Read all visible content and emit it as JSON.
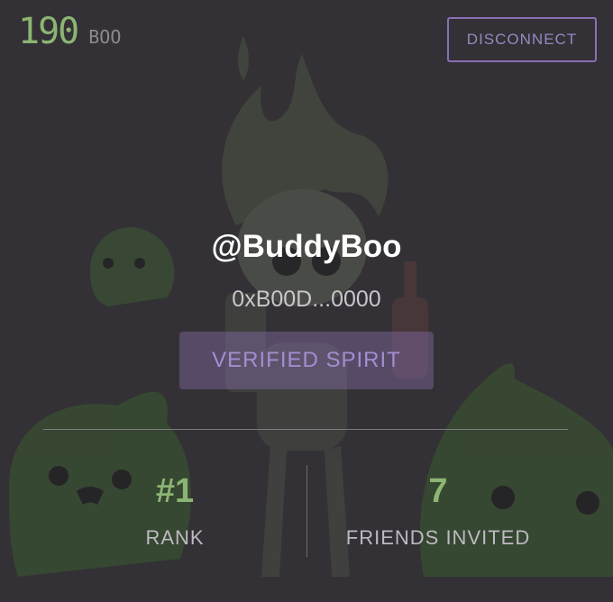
{
  "balance": {
    "value": "190",
    "unit": "BOO"
  },
  "header": {
    "disconnect_label": "DISCONNECT"
  },
  "profile": {
    "username": "@BuddyBoo",
    "address": "0xB00D...0000",
    "badge": "VERIFIED SPIRIT"
  },
  "stats": [
    {
      "value": "#1",
      "label": "RANK"
    },
    {
      "value": "7",
      "label": "FRIENDS INVITED"
    }
  ],
  "colors": {
    "background": "#333135",
    "accent_green": "#8cb573",
    "accent_purple": "#8a6fb4"
  }
}
